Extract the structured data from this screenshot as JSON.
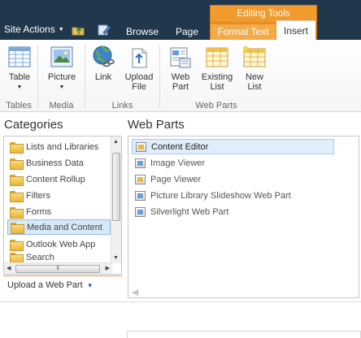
{
  "topbar": {
    "site_actions": "Site Actions",
    "context_group": "Editing Tools",
    "tabs": [
      {
        "label": "Browse"
      },
      {
        "label": "Page"
      },
      {
        "label": "Format Text"
      },
      {
        "label": "Insert"
      }
    ]
  },
  "ribbon": {
    "buttons": [
      {
        "label": "Table",
        "icon": "table-icon"
      },
      {
        "label": "Picture",
        "icon": "picture-icon"
      },
      {
        "label": "Link",
        "icon": "link-icon"
      },
      {
        "label_line1": "Upload",
        "label_line2": "File",
        "icon": "upload-file-icon"
      },
      {
        "label_line1": "Web",
        "label_line2": "Part",
        "icon": "web-part-icon"
      },
      {
        "label_line1": "Existing",
        "label_line2": "List",
        "icon": "existing-list-icon"
      },
      {
        "label_line1": "New",
        "label_line2": "List",
        "icon": "new-list-icon"
      }
    ],
    "groups": [
      "Tables",
      "Media",
      "Links",
      "Web Parts"
    ]
  },
  "categories": {
    "title": "Categories",
    "items": [
      {
        "label": "Lists and Libraries"
      },
      {
        "label": "Business Data"
      },
      {
        "label": "Content Rollup"
      },
      {
        "label": "Filters"
      },
      {
        "label": "Forms"
      },
      {
        "label": "Media and Content"
      },
      {
        "label": "Outlook Web App"
      },
      {
        "label": "Search"
      }
    ],
    "selected": "Media and Content",
    "upload_label": "Upload a Web Part"
  },
  "web_parts": {
    "title": "Web Parts",
    "items": [
      {
        "label": "Content Editor"
      },
      {
        "label": "Image Viewer"
      },
      {
        "label": "Page Viewer"
      },
      {
        "label": "Picture Library Slideshow Web Part"
      },
      {
        "label": "Silverlight Web Part"
      }
    ],
    "selected": "Content Editor"
  },
  "colors": {
    "topbar": "#21374c",
    "context_tab": "#f09b2c",
    "selection": "#d7e9f8"
  }
}
